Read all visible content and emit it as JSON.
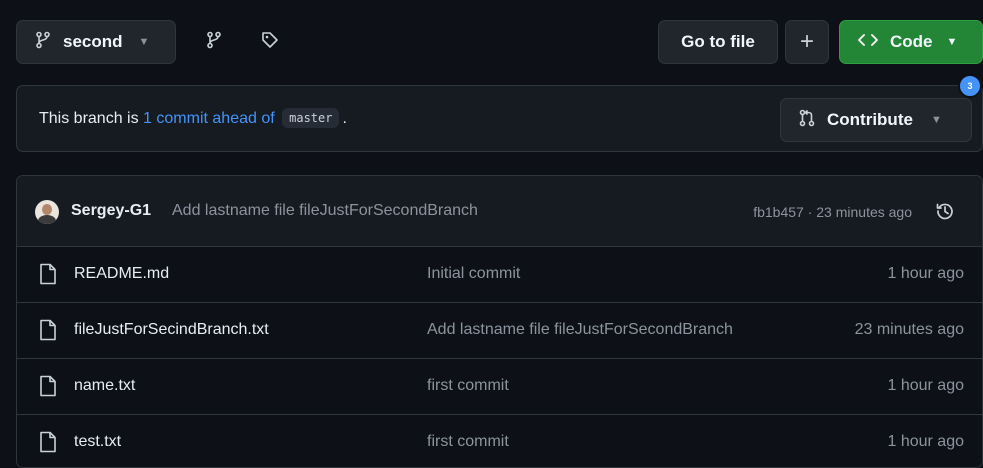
{
  "toolbar": {
    "branch_label": "second",
    "goto_file_label": "Go to file",
    "add_label": "+",
    "code_label": "Code"
  },
  "ahead_banner": {
    "prefix": "This branch is",
    "link_text": "1 commit ahead of",
    "base_branch": "master",
    "suffix": ".",
    "contribute_label": "Contribute",
    "badge": "3"
  },
  "latest_commit": {
    "author": "Sergey-G1",
    "message": "Add lastname file fileJustForSecondBranch",
    "meta": "fb1b457 · 23 minutes ago"
  },
  "files": [
    {
      "name": "README.md",
      "commit": "Initial commit",
      "age": "1 hour ago"
    },
    {
      "name": "fileJustForSecindBranch.txt",
      "commit": "Add lastname file fileJustForSecondBranch",
      "age": "23 minutes ago"
    },
    {
      "name": "name.txt",
      "commit": "first commit",
      "age": "1 hour ago"
    },
    {
      "name": "test.txt",
      "commit": "first commit",
      "age": "1 hour ago"
    }
  ],
  "colors": {
    "background": "#0d1117",
    "border": "#30363d",
    "link": "#4493f8",
    "code_button": "#238636",
    "muted_text": "#8b949e"
  },
  "icons": [
    "git-branch-icon",
    "caret-down-icon",
    "tag-icon",
    "code-brackets-icon",
    "pull-request-icon",
    "avatar",
    "history-icon",
    "file-icon"
  ]
}
